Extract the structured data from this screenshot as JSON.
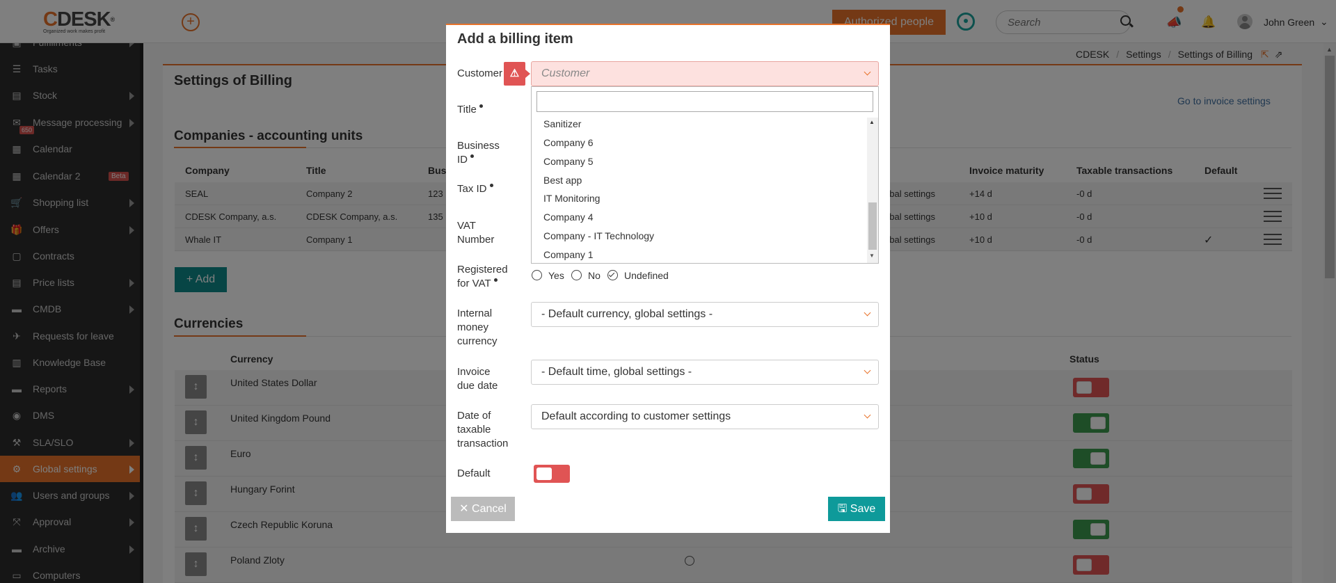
{
  "header": {
    "logo_text_c": "C",
    "logo_text_rest": "DESK",
    "logo_reg": "®",
    "logo_tagline": "Organized work makes profit",
    "add_icon": "plus-circle-icon",
    "authorized_label": "Authorized people",
    "search_placeholder": "Search",
    "user_name": "John Green"
  },
  "sidebar": {
    "items": [
      {
        "label": "Fulfillments",
        "icon": "box-icon"
      },
      {
        "label": "Tasks",
        "icon": "tasks-icon"
      },
      {
        "label": "Stock",
        "icon": "stock-icon"
      },
      {
        "label": "Message processing",
        "icon": "mail-icon",
        "count": "650"
      },
      {
        "label": "Calendar",
        "icon": "calendar-icon"
      },
      {
        "label": "Calendar 2",
        "icon": "calendar-icon",
        "badge": "Beta"
      },
      {
        "label": "Shopping list",
        "icon": "cart-icon"
      },
      {
        "label": "Offers",
        "icon": "gift-icon"
      },
      {
        "label": "Contracts",
        "icon": "contract-icon"
      },
      {
        "label": "Price lists",
        "icon": "pricelist-icon"
      },
      {
        "label": "CMDB",
        "icon": "folder-icon"
      },
      {
        "label": "Requests for leave",
        "icon": "plane-icon"
      },
      {
        "label": "Knowledge Base",
        "icon": "book-icon"
      },
      {
        "label": "Reports",
        "icon": "folder-icon"
      },
      {
        "label": "DMS",
        "icon": "database-icon"
      },
      {
        "label": "SLA/SLO",
        "icon": "gavel-icon"
      },
      {
        "label": "Global settings",
        "icon": "gears-icon"
      },
      {
        "label": "Users and groups",
        "icon": "users-icon"
      },
      {
        "label": "Approval",
        "icon": "approval-icon"
      },
      {
        "label": "Archive",
        "icon": "archive-icon"
      },
      {
        "label": "Computers",
        "icon": "laptop-icon"
      }
    ]
  },
  "breadcrumb": [
    "CDESK",
    "Settings",
    "Settings of Billing"
  ],
  "page": {
    "title": "Settings of Billing",
    "goto_invoice": "Go to invoice settings",
    "companies_title": "Companies - accounting units",
    "companies_headers": [
      "Company",
      "Title",
      "Bus",
      "Invoice maturity",
      "Taxable transactions",
      "Default"
    ],
    "companies_rows": [
      {
        "company": "SEAL",
        "title": "Company 2",
        "bus": "123",
        "global": "obal settings",
        "maturity": "+14 d",
        "taxable": "-0 d"
      },
      {
        "company": "CDESK Company, a.s.",
        "title": "CDESK Company, a.s.",
        "bus": "135",
        "global": "obal settings",
        "maturity": "+10 d",
        "taxable": "-0 d"
      },
      {
        "company": "Whale IT",
        "title": "Company 1",
        "bus": "",
        "global": "obal settings",
        "maturity": "+10 d",
        "taxable": "-0 d"
      }
    ],
    "add_label": "Add",
    "currencies_title": "Currencies",
    "currency_header": "Currency",
    "status_header": "Status",
    "currencies": [
      {
        "name": "United States Dollar",
        "status": "off"
      },
      {
        "name": "United Kingdom Pound",
        "status": "on"
      },
      {
        "name": "Euro",
        "status": "on"
      },
      {
        "name": "Hungary Forint",
        "status": "off"
      },
      {
        "name": "Czech Republic Koruna",
        "status": "on"
      },
      {
        "name": "Poland Zloty",
        "status": "off"
      }
    ]
  },
  "modal": {
    "title": "Add a billing item",
    "customer_label": "Customer",
    "customer_placeholder": "Customer",
    "title_label": "Title",
    "business_id_label_1": "Business",
    "business_id_label_2": "ID",
    "tax_id_label": "Tax ID",
    "vat_label_1": "VAT",
    "vat_label_2": "Number",
    "reg_vat_label_1": "Registered",
    "reg_vat_label_2": "for VAT",
    "reg_options": [
      "Yes",
      "No",
      "Undefined"
    ],
    "reg_selected": "Undefined",
    "internal_label": [
      "Internal",
      "money",
      "currency"
    ],
    "internal_value": "- Default currency, global settings -",
    "due_label": [
      "Invoice",
      "due date"
    ],
    "due_value": "- Default time, global settings -",
    "taxable_label": [
      "Date of",
      "taxable",
      "transaction"
    ],
    "taxable_value": "Default according to customer settings",
    "default_label": "Default",
    "cancel_label": "Cancel",
    "save_label": "Save",
    "dropdown_options": [
      "Sanitizer",
      "Company 6",
      "Company 5",
      "Best app",
      "IT Monitoring",
      "Company 4",
      "Company - IT Technology",
      "Company 1"
    ]
  },
  "colors": {
    "accent": "#e8732a",
    "teal": "#0e9a9a",
    "sidebar_bg": "#2d2d2d",
    "error": "#e05454",
    "success": "#3c9a4e"
  }
}
